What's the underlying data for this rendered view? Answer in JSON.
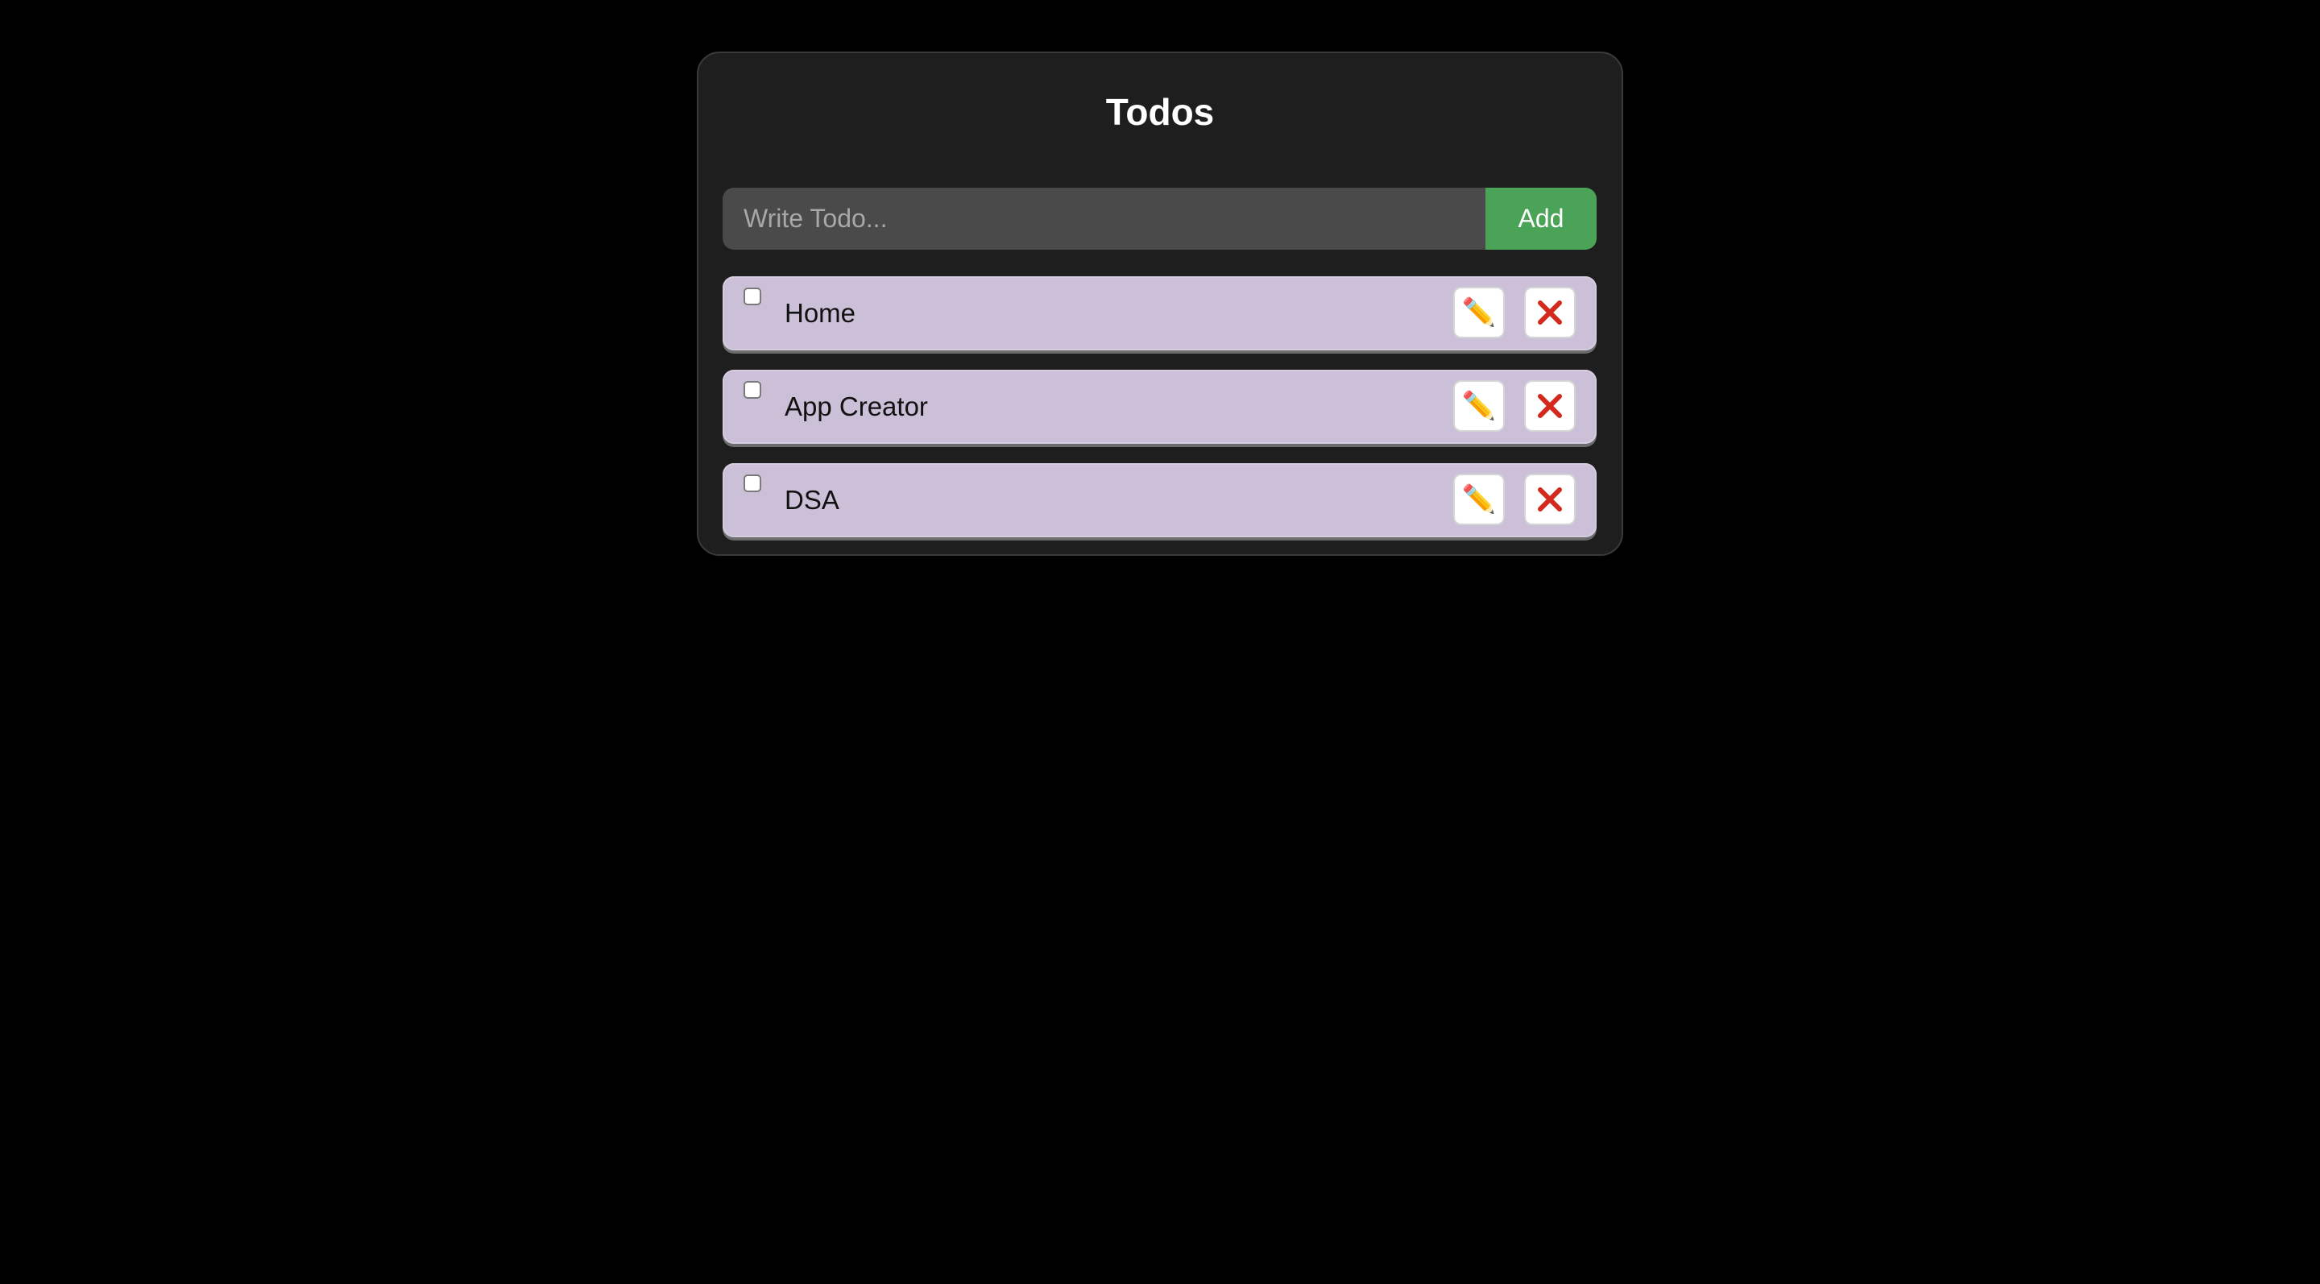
{
  "app": {
    "title": "Todos"
  },
  "new_todo": {
    "placeholder": "Write Todo...",
    "value": "",
    "add_label": "Add"
  },
  "todos": [
    {
      "text": "Home",
      "completed": false
    },
    {
      "text": "App Creator",
      "completed": false
    },
    {
      "text": "DSA",
      "completed": false
    }
  ],
  "icons": {
    "edit": "pencil-icon",
    "delete": "close-icon"
  },
  "colors": {
    "background": "#000000",
    "card": "#1e1e1e",
    "input": "#4a4a4a",
    "add_button": "#4aa356",
    "todo_item": "#ccc0d8",
    "delete_x": "#d42a1e"
  }
}
